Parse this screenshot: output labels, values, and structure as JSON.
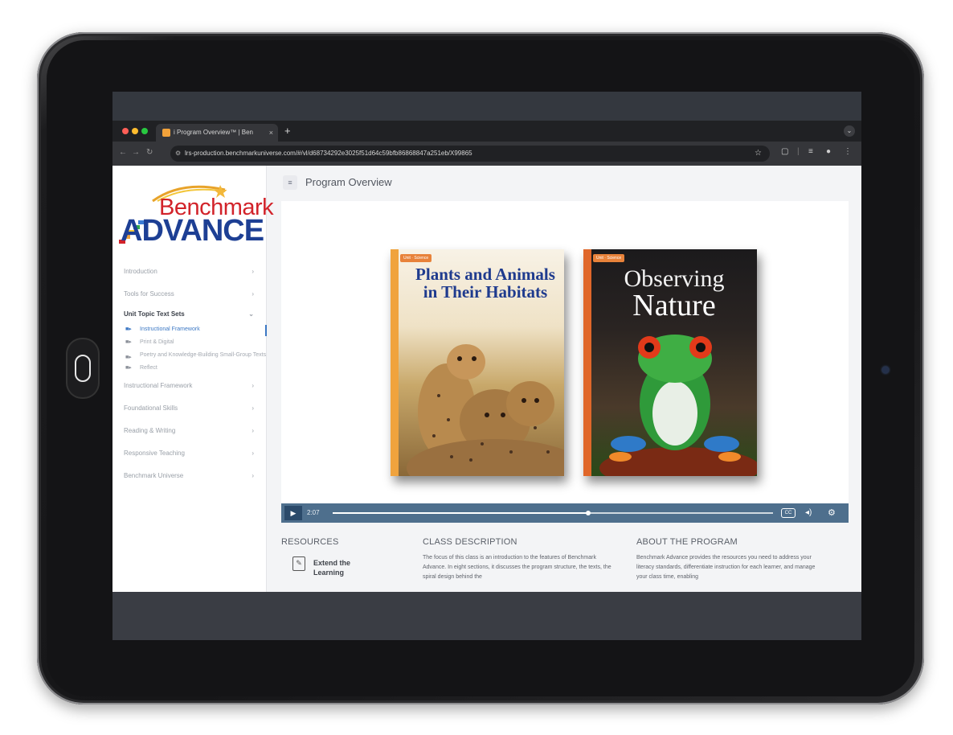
{
  "browser": {
    "tab_title": "i Program Overview™ | Ben",
    "tab_close": "×",
    "new_tab": "+",
    "url": "lrs-production.benchmarkuniverse.com/#/vl/d68734292e3025f51d64c59bfb86868847a251eb/X99865",
    "traffic_colors": [
      "#ff5f57",
      "#febc2e",
      "#28c840"
    ]
  },
  "logo": {
    "line1": "Benchmark",
    "line2": "ADVANCE"
  },
  "sidebar": {
    "items": [
      {
        "label": "Introduction",
        "chevron": "›"
      },
      {
        "label": "Tools for Success",
        "chevron": "›"
      },
      {
        "label": "Unit Topic Text Sets",
        "chevron": "⌄"
      },
      {
        "label": "Instructional Framework",
        "chevron": "›"
      },
      {
        "label": "Foundational Skills",
        "chevron": "›"
      },
      {
        "label": "Reading & Writing",
        "chevron": "›"
      },
      {
        "label": "Responsive Teaching",
        "chevron": "›"
      },
      {
        "label": "Benchmark Universe",
        "chevron": "›"
      }
    ],
    "subitems": [
      "Instructional Framework",
      "Print & Digital",
      "Poetry and Knowledge-Building Small-Group Texts",
      "Reflect"
    ]
  },
  "main": {
    "title": "Program Overview"
  },
  "video": {
    "book1": {
      "badge": "Unit · Science",
      "title": "Plants and Animals in Their Habitats"
    },
    "book2": {
      "badge": "Unit · Science",
      "title_line1": "Observing",
      "title_line2": "Nature"
    },
    "time": "2:07",
    "progress": 0.58,
    "cc_label": "CC"
  },
  "sections": {
    "resources": {
      "heading": "RESOURCES",
      "item_label": "Extend the Learning"
    },
    "class_description": {
      "heading": "CLASS DESCRIPTION",
      "text": "The focus of this class is an introduction to the features of Benchmark Advance. In eight sections, it discusses the program structure, the texts, the spiral design behind the"
    },
    "about": {
      "heading": "ABOUT THE PROGRAM",
      "text": "Benchmark Advance provides the resources you need to address your literacy standards, differentiate instruction for each learner, and manage your class time, enabling"
    }
  }
}
